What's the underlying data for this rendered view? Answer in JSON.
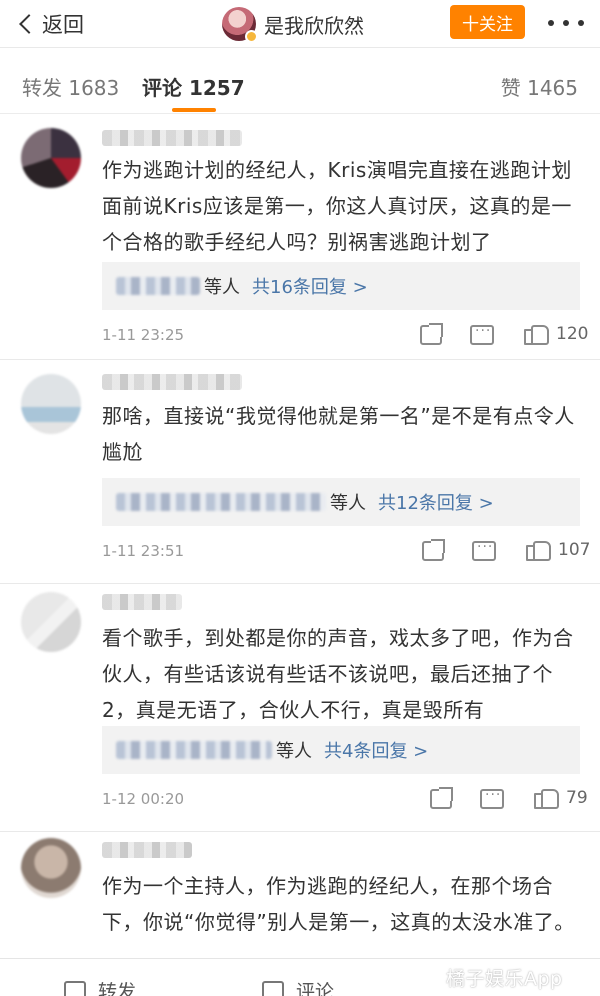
{
  "header": {
    "back_label": "返回",
    "title": "是我欣欣然",
    "follow_label": "十关注"
  },
  "tabs": {
    "repost": "转发 1683",
    "comment": "评论 1257",
    "like": "赞 1465"
  },
  "comments": [
    {
      "text": "作为逃跑计划的经纪人，Kris演唱完直接在逃跑计划面前说Kris应该是第一，你这人真讨厌，这真的是一个合格的歌手经纪人吗？别祸害逃跑计划了",
      "reply_suffix": "等人",
      "reply_link": "共16条回复 >",
      "time": "1-11 23:25",
      "likes": "120"
    },
    {
      "text": "那啥，直接说“我觉得他就是第一名”是不是有点令人尴尬",
      "reply_suffix": "等人",
      "reply_link": "共12条回复 >",
      "time": "1-11 23:51",
      "likes": "107"
    },
    {
      "text": "看个歌手，到处都是你的声音，戏太多了吧，作为合伙人，有些话该说有些话不该说吧，最后还抽了个2，真是无语了，合伙人不行，真是毁所有",
      "reply_suffix": "等人",
      "reply_link": "共4条回复 >",
      "time": "1-12 00:20",
      "likes": "79"
    },
    {
      "text": "作为一个主持人，作为逃跑的经纪人，在那个场合下，你说“你觉得”别人是第一，这真的太没水准了。"
    }
  ],
  "bottom": {
    "repost": "转发",
    "comment": "评论",
    "watermark": "橘子娱乐App"
  },
  "icons": {
    "back": "chevron-left-icon",
    "more": "more-dots-icon",
    "share": "share-icon",
    "comment": "comment-icon",
    "like": "thumbs-up-icon"
  },
  "colors": {
    "accent": "#ff8200",
    "link": "#4a76a8"
  }
}
